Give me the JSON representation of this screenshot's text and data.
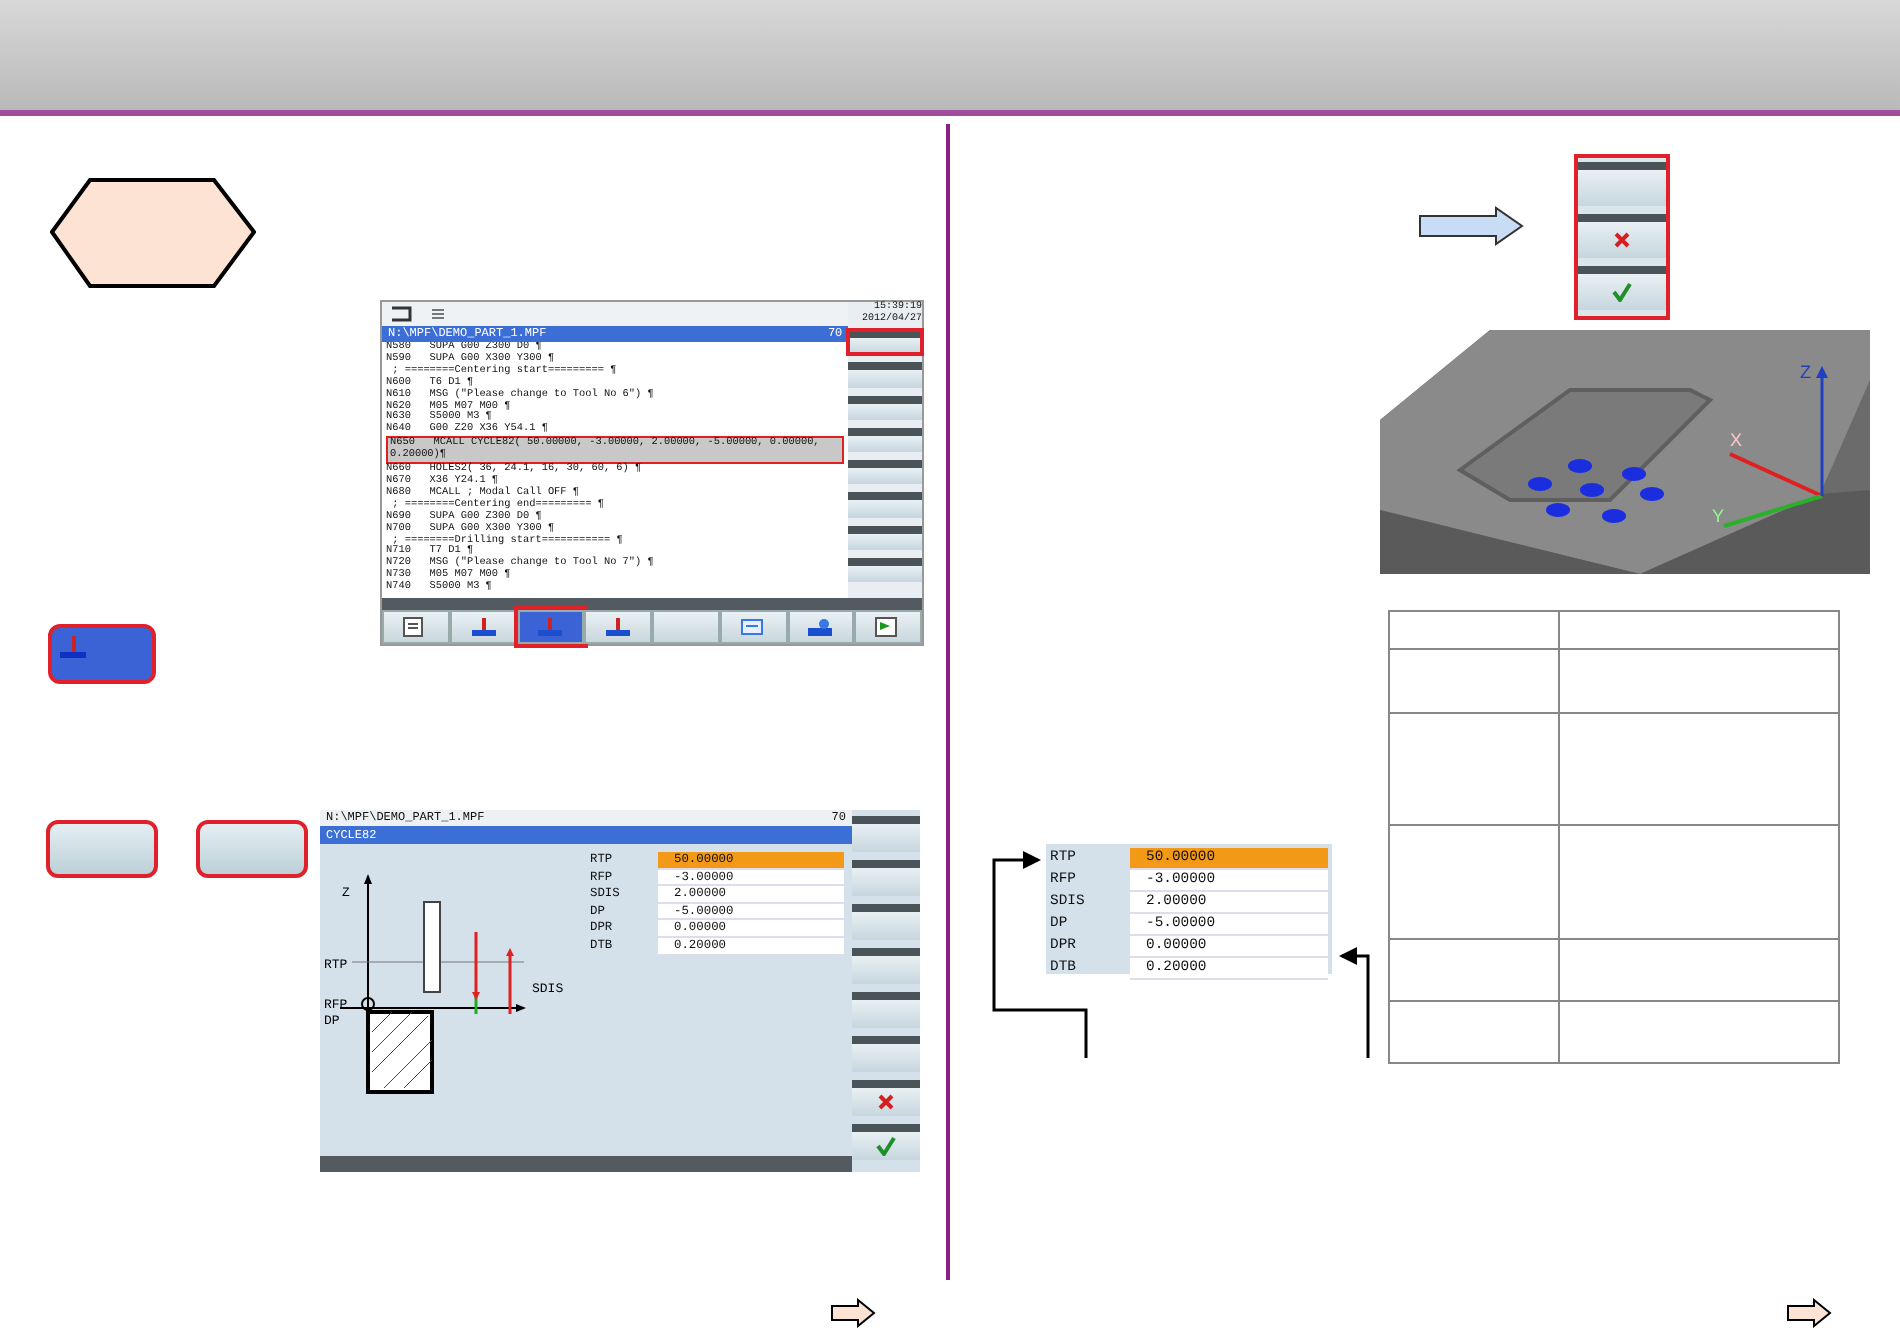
{
  "screen1": {
    "time": "15:39:19",
    "date": "2012/04/27",
    "path": "N:\\MPF\\DEMO_PART_1.MPF",
    "count": "70",
    "lines": [
      {
        "text": "N580   SUPA G00 Z300 D0 ¶",
        "selected": false
      },
      {
        "text": "N590   SUPA G00 X300 Y300 ¶",
        "selected": false
      },
      {
        "text": " ; ========Centering start========= ¶",
        "selected": false
      },
      {
        "text": "N600   T6 D1 ¶",
        "selected": false
      },
      {
        "text": "N610   MSG (\"Please change to Tool No 6\") ¶",
        "selected": false
      },
      {
        "text": "N620   M05 M07 M00 ¶",
        "selected": false
      },
      {
        "text": "N630   S5000 M3 ¶",
        "selected": false
      },
      {
        "text": "N640   G00 Z20 X36 Y54.1 ¶",
        "selected": false
      },
      {
        "text": "N650   MCALL CYCLE82( 50.00000, -3.00000, 2.00000, -5.00000, 0.00000, 0.20000)¶",
        "selected": true
      },
      {
        "text": "N660   HOLES2( 36, 24.1, 16, 30, 60, 6) ¶",
        "selected": false
      },
      {
        "text": "N670   X36 Y24.1 ¶",
        "selected": false
      },
      {
        "text": "N680   MCALL ; Modal Call OFF ¶",
        "selected": false
      },
      {
        "text": " ; ========Centering end========= ¶",
        "selected": false
      },
      {
        "text": "N690   SUPA G00 Z300 D0 ¶",
        "selected": false
      },
      {
        "text": "N700   SUPA G00 X300 Y300 ¶",
        "selected": false
      },
      {
        "text": " ; ========Drilling start=========== ¶",
        "selected": false
      },
      {
        "text": "N710   T7 D1 ¶",
        "selected": false
      },
      {
        "text": "N720   MSG (\"Please change to Tool No 7\") ¶",
        "selected": false
      },
      {
        "text": "N730   M05 M07 M00 ¶",
        "selected": false
      },
      {
        "text": "N740   S5000 M3 ¶",
        "selected": false
      }
    ],
    "side_softkeys": [
      {
        "marked": true
      },
      {
        "marked": false
      },
      {
        "marked": false
      },
      {
        "marked": false
      },
      {
        "marked": false
      },
      {
        "marked": false
      },
      {
        "marked": false
      },
      {
        "marked": false
      }
    ],
    "bottom_softkeys": [
      {
        "kind": "edit",
        "selected": false,
        "marked": false
      },
      {
        "kind": "drill",
        "selected": false,
        "marked": false
      },
      {
        "kind": "drill",
        "selected": true,
        "marked": true
      },
      {
        "kind": "drill",
        "selected": false,
        "marked": false
      },
      {
        "kind": "blank",
        "selected": false,
        "marked": false
      },
      {
        "kind": "contour",
        "selected": false,
        "marked": false
      },
      {
        "kind": "mill",
        "selected": false,
        "marked": false
      },
      {
        "kind": "sim",
        "selected": false,
        "marked": false
      }
    ]
  },
  "screen2": {
    "path": "N:\\MPF\\DEMO_PART_1.MPF",
    "count": "70",
    "title": "CYCLE82",
    "diagram_labels": [
      "Z",
      "RTP",
      "RFP",
      "DP",
      "SDIS"
    ],
    "params": [
      {
        "name": "RTP",
        "value": "50.00000",
        "selected": true
      },
      {
        "name": "RFP",
        "value": "-3.00000",
        "selected": false
      },
      {
        "name": "SDIS",
        "value": "2.00000",
        "selected": false
      },
      {
        "name": "DP",
        "value": "-5.00000",
        "selected": false
      },
      {
        "name": "DPR",
        "value": "0.00000",
        "selected": false
      },
      {
        "name": "DTB",
        "value": "0.20000",
        "selected": false
      }
    ],
    "softkeys": [
      {
        "kind": "blank"
      },
      {
        "kind": "blank"
      },
      {
        "kind": "blank"
      },
      {
        "kind": "blank"
      },
      {
        "kind": "blank"
      },
      {
        "kind": "blank"
      },
      {
        "kind": "cancel"
      },
      {
        "kind": "accept"
      }
    ]
  },
  "param_copy": [
    {
      "name": "RTP",
      "value": "50.00000",
      "selected": true
    },
    {
      "name": "RFP",
      "value": "-3.00000",
      "selected": false
    },
    {
      "name": "SDIS",
      "value": "2.00000",
      "selected": false
    },
    {
      "name": "DP",
      "value": "-5.00000",
      "selected": false
    },
    {
      "name": "DPR",
      "value": "0.00000",
      "selected": false
    },
    {
      "name": "DTB",
      "value": "0.20000",
      "selected": false
    }
  ],
  "softkey_stack": [
    {
      "kind": "blank"
    },
    {
      "kind": "cancel"
    },
    {
      "kind": "accept"
    }
  ],
  "axis_labels": [
    "X",
    "Y",
    "Z"
  ]
}
